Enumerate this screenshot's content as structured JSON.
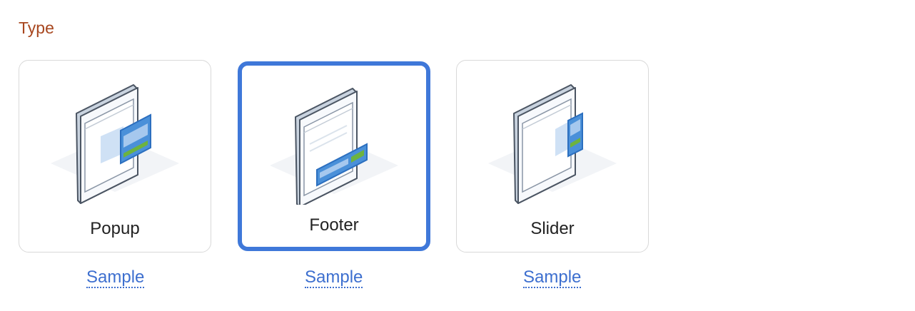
{
  "section": {
    "title": "Type"
  },
  "cards": [
    {
      "label": "Popup",
      "link": "Sample",
      "selected": false,
      "icon": "popup-window-icon"
    },
    {
      "label": "Footer",
      "link": "Sample",
      "selected": true,
      "icon": "footer-bar-icon"
    },
    {
      "label": "Slider",
      "link": "Sample",
      "selected": false,
      "icon": "slider-panel-icon"
    }
  ],
  "colors": {
    "title": "#a8471f",
    "selected_border": "#3f78d9",
    "link": "#3d6fcf",
    "accent_blue": "#4a90d9",
    "accent_green": "#6db33f"
  }
}
